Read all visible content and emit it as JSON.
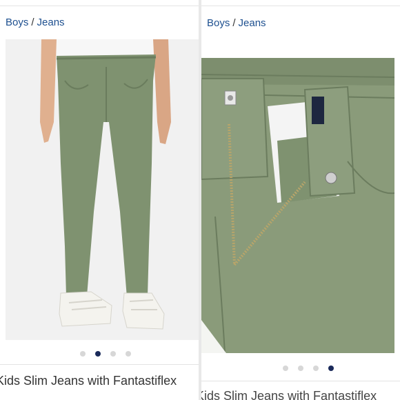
{
  "left": {
    "breadcrumb": {
      "category": "Boys",
      "separator": "/",
      "subcategory": "Jeans"
    },
    "image_alt": "Kids slim jeans in green, front view worn with white sneakers",
    "carousel": {
      "count": 4,
      "active": 2
    },
    "title": "Kids Slim Jeans with Fantastiflex"
  },
  "right": {
    "breadcrumb": {
      "category": "Boys",
      "separator": "/",
      "subcategory": "Jeans"
    },
    "image_alt": "Close-up of waistband, zipper fly and button of green jeans",
    "carousel": {
      "count": 4,
      "active": 4
    },
    "title": "Kids Slim Jeans with Fantastiflex"
  },
  "colors": {
    "link": "#1d4f8f",
    "jeans": "#7f9270",
    "dot_active": "#1a2a5a",
    "dot_inactive": "#d7d7d7"
  }
}
